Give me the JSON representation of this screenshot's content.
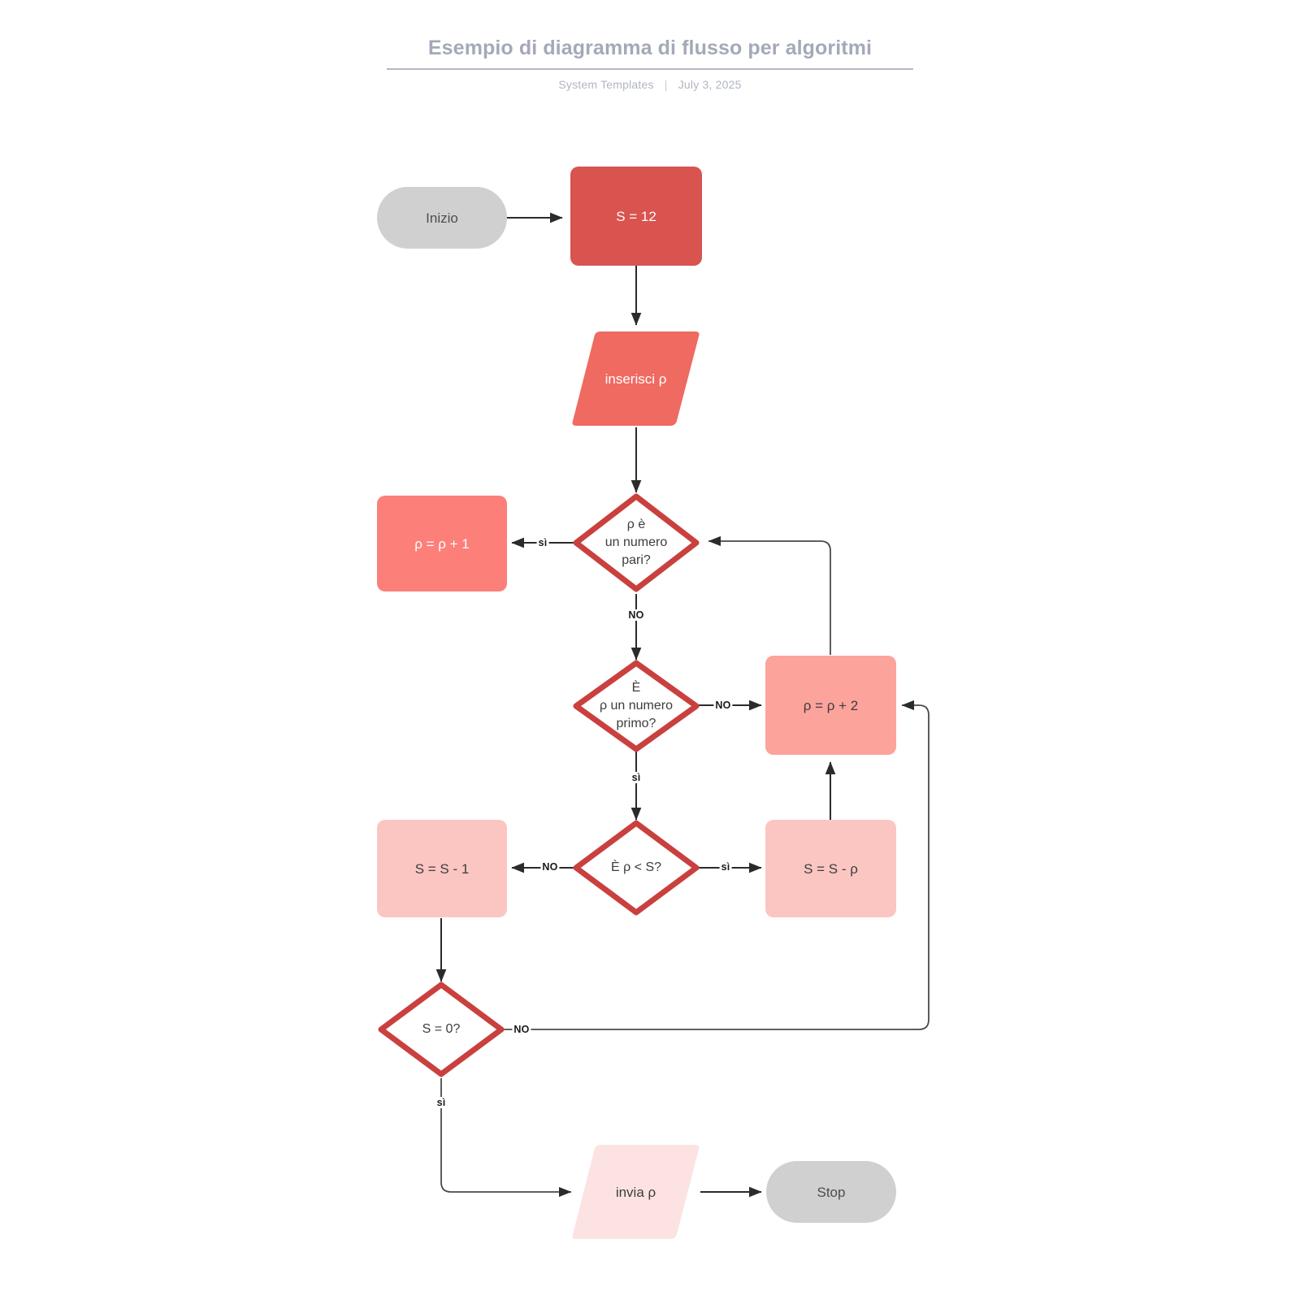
{
  "header": {
    "title": "Esempio di diagramma di flusso per algoritmi",
    "author": "System Templates",
    "separator": "|",
    "date": "July 3, 2025"
  },
  "theme": {
    "title_color": "#a4a9b8",
    "subtitle_color": "#b0b5c2",
    "terminal_fill": "#d0d0d0",
    "tone_1": "#d9534f",
    "tone_2": "#ef6a61",
    "tone_3": "#fc8079",
    "tone_4": "#fca39c",
    "tone_5": "#fbc6c2",
    "tone_6": "#fce3e1",
    "diamond_stroke": "#c9403e",
    "connector_color": "#3d3d3d"
  },
  "flowchart": {
    "nodes": [
      {
        "id": "inizio",
        "label": "Inizio",
        "shape": "terminal"
      },
      {
        "id": "s12",
        "label": "S = 12",
        "shape": "process"
      },
      {
        "id": "inserisci",
        "label": "inserisci ρ",
        "shape": "io"
      },
      {
        "id": "pari",
        "label": "ρ è\nun numero\npari?",
        "shape": "decision"
      },
      {
        "id": "rho1",
        "label": "ρ = ρ + 1",
        "shape": "process"
      },
      {
        "id": "primo",
        "label": "È\nρ un numero\nprimo?",
        "shape": "decision"
      },
      {
        "id": "rho2",
        "label": "ρ = ρ + 2",
        "shape": "process"
      },
      {
        "id": "rholts",
        "label": "È ρ < S?",
        "shape": "decision"
      },
      {
        "id": "ssm1",
        "label": "S = S - 1",
        "shape": "process"
      },
      {
        "id": "ssmrho",
        "label": "S = S - ρ",
        "shape": "process"
      },
      {
        "id": "szero",
        "label": "S = 0?",
        "shape": "decision"
      },
      {
        "id": "invia",
        "label": "invia ρ",
        "shape": "io"
      },
      {
        "id": "stop",
        "label": "Stop",
        "shape": "terminal"
      }
    ],
    "edges": [
      {
        "from": "inizio",
        "to": "s12",
        "label": ""
      },
      {
        "from": "s12",
        "to": "inserisci",
        "label": ""
      },
      {
        "from": "inserisci",
        "to": "pari",
        "label": ""
      },
      {
        "from": "pari",
        "to": "rho1",
        "label": "sì"
      },
      {
        "from": "pari",
        "to": "primo",
        "label": "NO"
      },
      {
        "from": "primo",
        "to": "rho2",
        "label": "NO"
      },
      {
        "from": "primo",
        "to": "rholts",
        "label": "sì"
      },
      {
        "from": "rholts",
        "to": "ssm1",
        "label": "NO"
      },
      {
        "from": "rholts",
        "to": "ssmrho",
        "label": "sì"
      },
      {
        "from": "ssmrho",
        "to": "rho2",
        "label": ""
      },
      {
        "from": "rho2",
        "to": "pari",
        "label": ""
      },
      {
        "from": "ssm1",
        "to": "szero",
        "label": ""
      },
      {
        "from": "szero",
        "to": "rho2",
        "label": "NO"
      },
      {
        "from": "szero",
        "to": "invia",
        "label": "sì"
      },
      {
        "from": "invia",
        "to": "stop",
        "label": ""
      }
    ],
    "edge_labels": [
      {
        "id": "pari-si",
        "text": "sì"
      },
      {
        "id": "pari-no",
        "text": "NO"
      },
      {
        "id": "primo-no",
        "text": "NO"
      },
      {
        "id": "primo-si",
        "text": "sì"
      },
      {
        "id": "lts-no",
        "text": "NO"
      },
      {
        "id": "lts-si",
        "text": "sì"
      },
      {
        "id": "szero-no",
        "text": "NO"
      },
      {
        "id": "szero-si",
        "text": "sì"
      }
    ]
  }
}
